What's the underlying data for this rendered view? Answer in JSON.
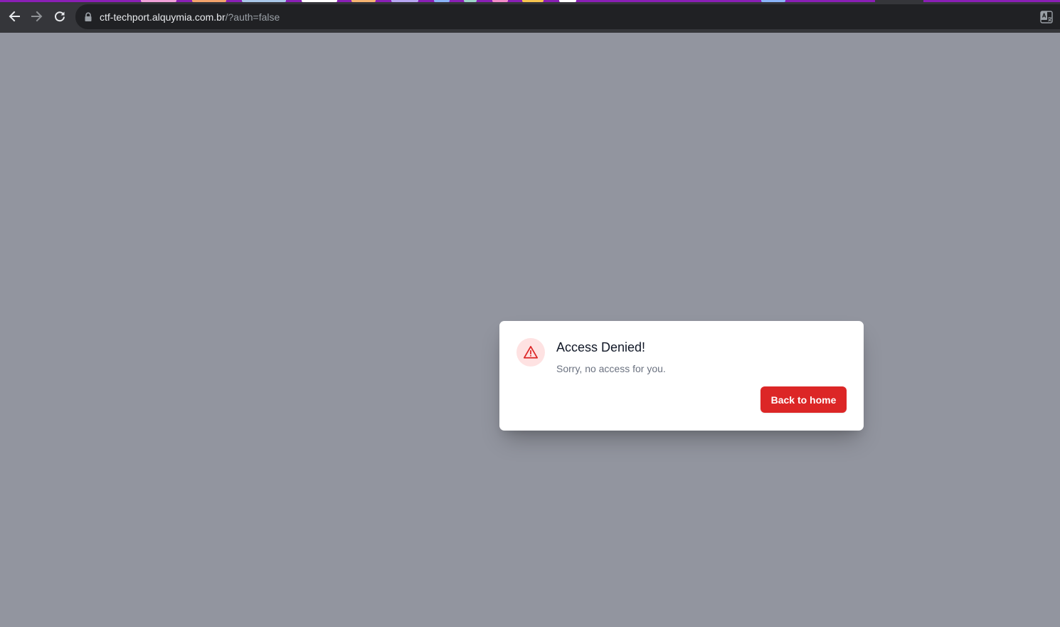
{
  "browser": {
    "url_host": "ctf-techport.alquymia.com.br",
    "url_path": "/?auth=false",
    "icons": {
      "back": "arrow-left-icon",
      "forward": "arrow-right-icon",
      "reload": "reload-icon",
      "security": "lock-icon",
      "translate": "translate-icon"
    },
    "colors": {
      "toolbar": "#35363a",
      "omnibox": "#202124",
      "tabstrip_accent": "#8a1fb5"
    }
  },
  "page": {
    "background_color": "#92959f"
  },
  "dialog": {
    "title": "Access Denied!",
    "message": "Sorry, no access for you.",
    "button_label": "Back to home",
    "icon": "warning-triangle-icon",
    "colors": {
      "accent": "#dc2626",
      "icon_background": "#fee2e2",
      "title": "#111827",
      "message": "#6b7280"
    }
  }
}
